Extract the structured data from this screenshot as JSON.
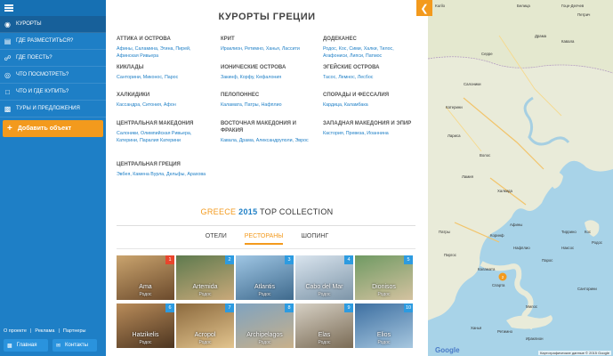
{
  "sidebar": {
    "items": [
      {
        "label": "КУРОРТЫ",
        "icon": "map-pin-icon",
        "active": true
      },
      {
        "label": "ГДЕ РАЗМЕСТИТЬСЯ?",
        "icon": "bed-icon"
      },
      {
        "label": "ГДЕ ПОЕСТЬ?",
        "icon": "fork-knife-icon"
      },
      {
        "label": "ЧТО ПОСМОТРЕТЬ?",
        "icon": "eye-icon"
      },
      {
        "label": "ЧТО И ГДЕ КУПИТЬ?",
        "icon": "shopping-bag-icon"
      },
      {
        "label": "ТУРЫ И ПРЕДЛОЖЕНИЯ",
        "icon": "suitcase-icon"
      }
    ],
    "add_label": "Добавить объект",
    "links": [
      "О проекте",
      "Реклама",
      "Партнеры"
    ],
    "home_label": "Главная",
    "contacts_label": "Контакты"
  },
  "page": {
    "title": "КУРОРТЫ ГРЕЦИИ"
  },
  "regions": [
    {
      "name": "АТТИКА И ОСТРОВА",
      "places": "Афины, Саламина, Эгина, Пирей, Афинская Ривьера"
    },
    {
      "name": "КРИТ",
      "places": "Ираклион, Ретимно, Ханья, Лассити"
    },
    {
      "name": "ДОДЕКАНЕС",
      "places": "Родос, Кос, Сими, Халки, Тилос, Агафониси, Липси, Патмос"
    },
    {
      "name": "КИКЛАДЫ",
      "places": "Санторини, Миконос, Парос"
    },
    {
      "name": "ИОНИЧЕСКИЕ ОСТРОВА",
      "places": "Закинф, Корфу, Кефалония"
    },
    {
      "name": "ЭГЕЙСКИЕ ОСТРОВА",
      "places": "Тасос, Лемнос, Лесбос"
    },
    {
      "name": "ХАЛКИДИКИ",
      "places": "Кассандра, Ситония, Афон"
    },
    {
      "name": "ПЕЛОПОННЕС",
      "places": "Каламата, Патры, Нафплио"
    },
    {
      "name": "СПОРАДЫ И ФЕССАЛИЯ",
      "places": "Кардица, Каламбака"
    },
    {
      "name": "ЦЕНТРАЛЬНАЯ МАКЕДОНИЯ",
      "places": "Салоники, Олимпийская Ривьера, Катерини, Паралия Катерини"
    },
    {
      "name": "ВОСТОЧНАЯ МАКЕДОНИЯ И ФРАКИЯ",
      "places": "Кавала, Драма, Александруполи, Эврос"
    },
    {
      "name": "ЗАПАДНАЯ МАКЕДОНИЯ И ЭПИР",
      "places": "Кастория, Превеза, Иоаннина"
    },
    {
      "name": "ЦЕНТРАЛЬНАЯ ГРЕЦИЯ",
      "places": "Эвбея, Камена Вурла, Дельфы, Арахова"
    }
  ],
  "collection": {
    "country": "GREECE",
    "year": "2015",
    "suffix": "TOP COLLECTION",
    "tabs": [
      "ОТЕЛИ",
      "РЕСТОРАНЫ",
      "ШОПИНГ"
    ],
    "active_tab": "РЕСТОРАНЫ",
    "items": [
      {
        "rank": "1",
        "name": "Ama",
        "location": "Родос",
        "badge": "#e8452c",
        "bg1": "#caa46e",
        "bg2": "#6b4a2c"
      },
      {
        "rank": "2",
        "name": "Artemida",
        "location": "Родос",
        "badge": "#2d9be0",
        "bg1": "#5e7a4e",
        "bg2": "#c9a97a"
      },
      {
        "rank": "3",
        "name": "Atlantis",
        "location": "Родос",
        "badge": "#2d9be0",
        "bg1": "#9fc6e4",
        "bg2": "#3f6a8d"
      },
      {
        "rank": "4",
        "name": "Cabo del Mar",
        "location": "Родос",
        "badge": "#2d9be0",
        "bg1": "#d9e4ee",
        "bg2": "#7d95a8"
      },
      {
        "rank": "5",
        "name": "Dionisos",
        "location": "Родос",
        "badge": "#2d9be0",
        "bg1": "#6f9a63",
        "bg2": "#d4c2a0"
      },
      {
        "rank": "6",
        "name": "Hatzikelis",
        "location": "Родос",
        "badge": "#2d9be0",
        "bg1": "#b98c5a",
        "bg2": "#4d3520"
      },
      {
        "rank": "7",
        "name": "Acropol",
        "location": "Родос",
        "badge": "#2d9be0",
        "bg1": "#8c6a3e",
        "bg2": "#e2c48e"
      },
      {
        "rank": "8",
        "name": "Archipelagos",
        "location": "Родос",
        "badge": "#2d9be0",
        "bg1": "#7fa3c0",
        "bg2": "#c8b08a"
      },
      {
        "rank": "9",
        "name": "Elas",
        "location": "Родос",
        "badge": "#2d9be0",
        "bg1": "#d6d0c4",
        "bg2": "#7a6b55"
      },
      {
        "rank": "10",
        "name": "Elios",
        "location": "Родос",
        "badge": "#2d9be0",
        "bg1": "#3d6fa1",
        "bg2": "#a7c7df"
      }
    ]
  },
  "map": {
    "cities": [
      "Kurilo",
      "Белица",
      "Гоце-Делчев",
      "Петрич",
      "Кавала",
      "Драма",
      "Серре",
      "Салоники",
      "Катерини",
      "Лариса",
      "Волос",
      "Ламия",
      "Халкида",
      "Афины",
      "Патры",
      "Пиргос",
      "Каламата",
      "Спарта",
      "Нафплио",
      "Коринф",
      "Тиррино",
      "Наксос",
      "Парос",
      "Милос",
      "Санторини",
      "Ираклион",
      "Ханья",
      "Ретимно",
      "Кос",
      "Родос"
    ],
    "copyright": "Картографические данные © 2015 Google",
    "brand": "Google"
  },
  "colors": {
    "primary": "#1e7fc6",
    "accent": "#f39a1d"
  }
}
